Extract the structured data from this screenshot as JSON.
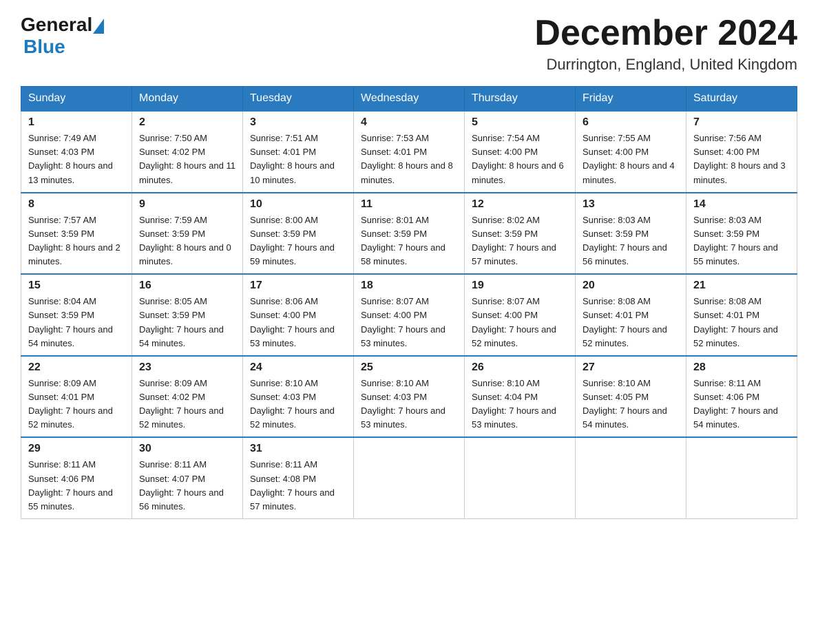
{
  "logo": {
    "general": "General",
    "blue": "Blue"
  },
  "title": {
    "month": "December 2024",
    "location": "Durrington, England, United Kingdom"
  },
  "headers": [
    "Sunday",
    "Monday",
    "Tuesday",
    "Wednesday",
    "Thursday",
    "Friday",
    "Saturday"
  ],
  "weeks": [
    [
      {
        "day": "1",
        "sunrise": "Sunrise: 7:49 AM",
        "sunset": "Sunset: 4:03 PM",
        "daylight": "Daylight: 8 hours and 13 minutes."
      },
      {
        "day": "2",
        "sunrise": "Sunrise: 7:50 AM",
        "sunset": "Sunset: 4:02 PM",
        "daylight": "Daylight: 8 hours and 11 minutes."
      },
      {
        "day": "3",
        "sunrise": "Sunrise: 7:51 AM",
        "sunset": "Sunset: 4:01 PM",
        "daylight": "Daylight: 8 hours and 10 minutes."
      },
      {
        "day": "4",
        "sunrise": "Sunrise: 7:53 AM",
        "sunset": "Sunset: 4:01 PM",
        "daylight": "Daylight: 8 hours and 8 minutes."
      },
      {
        "day": "5",
        "sunrise": "Sunrise: 7:54 AM",
        "sunset": "Sunset: 4:00 PM",
        "daylight": "Daylight: 8 hours and 6 minutes."
      },
      {
        "day": "6",
        "sunrise": "Sunrise: 7:55 AM",
        "sunset": "Sunset: 4:00 PM",
        "daylight": "Daylight: 8 hours and 4 minutes."
      },
      {
        "day": "7",
        "sunrise": "Sunrise: 7:56 AM",
        "sunset": "Sunset: 4:00 PM",
        "daylight": "Daylight: 8 hours and 3 minutes."
      }
    ],
    [
      {
        "day": "8",
        "sunrise": "Sunrise: 7:57 AM",
        "sunset": "Sunset: 3:59 PM",
        "daylight": "Daylight: 8 hours and 2 minutes."
      },
      {
        "day": "9",
        "sunrise": "Sunrise: 7:59 AM",
        "sunset": "Sunset: 3:59 PM",
        "daylight": "Daylight: 8 hours and 0 minutes."
      },
      {
        "day": "10",
        "sunrise": "Sunrise: 8:00 AM",
        "sunset": "Sunset: 3:59 PM",
        "daylight": "Daylight: 7 hours and 59 minutes."
      },
      {
        "day": "11",
        "sunrise": "Sunrise: 8:01 AM",
        "sunset": "Sunset: 3:59 PM",
        "daylight": "Daylight: 7 hours and 58 minutes."
      },
      {
        "day": "12",
        "sunrise": "Sunrise: 8:02 AM",
        "sunset": "Sunset: 3:59 PM",
        "daylight": "Daylight: 7 hours and 57 minutes."
      },
      {
        "day": "13",
        "sunrise": "Sunrise: 8:03 AM",
        "sunset": "Sunset: 3:59 PM",
        "daylight": "Daylight: 7 hours and 56 minutes."
      },
      {
        "day": "14",
        "sunrise": "Sunrise: 8:03 AM",
        "sunset": "Sunset: 3:59 PM",
        "daylight": "Daylight: 7 hours and 55 minutes."
      }
    ],
    [
      {
        "day": "15",
        "sunrise": "Sunrise: 8:04 AM",
        "sunset": "Sunset: 3:59 PM",
        "daylight": "Daylight: 7 hours and 54 minutes."
      },
      {
        "day": "16",
        "sunrise": "Sunrise: 8:05 AM",
        "sunset": "Sunset: 3:59 PM",
        "daylight": "Daylight: 7 hours and 54 minutes."
      },
      {
        "day": "17",
        "sunrise": "Sunrise: 8:06 AM",
        "sunset": "Sunset: 4:00 PM",
        "daylight": "Daylight: 7 hours and 53 minutes."
      },
      {
        "day": "18",
        "sunrise": "Sunrise: 8:07 AM",
        "sunset": "Sunset: 4:00 PM",
        "daylight": "Daylight: 7 hours and 53 minutes."
      },
      {
        "day": "19",
        "sunrise": "Sunrise: 8:07 AM",
        "sunset": "Sunset: 4:00 PM",
        "daylight": "Daylight: 7 hours and 52 minutes."
      },
      {
        "day": "20",
        "sunrise": "Sunrise: 8:08 AM",
        "sunset": "Sunset: 4:01 PM",
        "daylight": "Daylight: 7 hours and 52 minutes."
      },
      {
        "day": "21",
        "sunrise": "Sunrise: 8:08 AM",
        "sunset": "Sunset: 4:01 PM",
        "daylight": "Daylight: 7 hours and 52 minutes."
      }
    ],
    [
      {
        "day": "22",
        "sunrise": "Sunrise: 8:09 AM",
        "sunset": "Sunset: 4:01 PM",
        "daylight": "Daylight: 7 hours and 52 minutes."
      },
      {
        "day": "23",
        "sunrise": "Sunrise: 8:09 AM",
        "sunset": "Sunset: 4:02 PM",
        "daylight": "Daylight: 7 hours and 52 minutes."
      },
      {
        "day": "24",
        "sunrise": "Sunrise: 8:10 AM",
        "sunset": "Sunset: 4:03 PM",
        "daylight": "Daylight: 7 hours and 52 minutes."
      },
      {
        "day": "25",
        "sunrise": "Sunrise: 8:10 AM",
        "sunset": "Sunset: 4:03 PM",
        "daylight": "Daylight: 7 hours and 53 minutes."
      },
      {
        "day": "26",
        "sunrise": "Sunrise: 8:10 AM",
        "sunset": "Sunset: 4:04 PM",
        "daylight": "Daylight: 7 hours and 53 minutes."
      },
      {
        "day": "27",
        "sunrise": "Sunrise: 8:10 AM",
        "sunset": "Sunset: 4:05 PM",
        "daylight": "Daylight: 7 hours and 54 minutes."
      },
      {
        "day": "28",
        "sunrise": "Sunrise: 8:11 AM",
        "sunset": "Sunset: 4:06 PM",
        "daylight": "Daylight: 7 hours and 54 minutes."
      }
    ],
    [
      {
        "day": "29",
        "sunrise": "Sunrise: 8:11 AM",
        "sunset": "Sunset: 4:06 PM",
        "daylight": "Daylight: 7 hours and 55 minutes."
      },
      {
        "day": "30",
        "sunrise": "Sunrise: 8:11 AM",
        "sunset": "Sunset: 4:07 PM",
        "daylight": "Daylight: 7 hours and 56 minutes."
      },
      {
        "day": "31",
        "sunrise": "Sunrise: 8:11 AM",
        "sunset": "Sunset: 4:08 PM",
        "daylight": "Daylight: 7 hours and 57 minutes."
      },
      null,
      null,
      null,
      null
    ]
  ]
}
